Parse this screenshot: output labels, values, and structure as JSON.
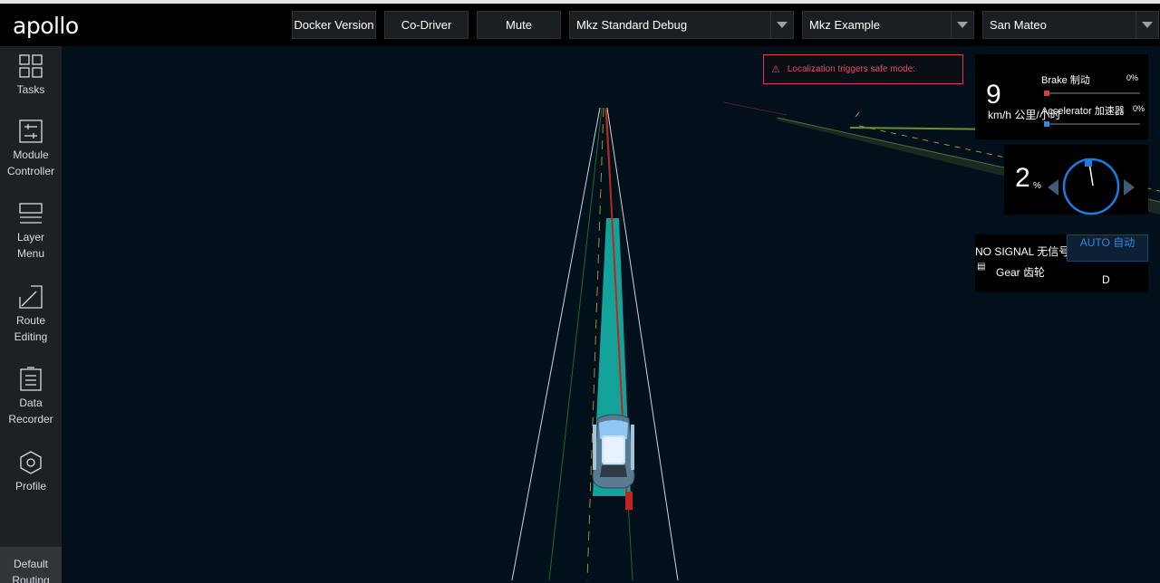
{
  "app": {
    "logo": "apollo"
  },
  "header": {
    "docker_btn": "Docker Version",
    "codriver_btn": "Co-Driver",
    "mute_btn": "Mute",
    "mode_select": "Mkz Standard Debug",
    "vehicle_select": "Mkz Example",
    "map_select": "San Mateo"
  },
  "sidebar": {
    "tasks": "Tasks",
    "module_controller": [
      "Module",
      "Controller"
    ],
    "layer_menu": [
      "Layer",
      "Menu"
    ],
    "route_editing": [
      "Route",
      "Editing"
    ],
    "data_recorder": [
      "Data",
      "Recorder"
    ],
    "profile": "Profile",
    "default_routing": [
      "Default",
      "Routing"
    ]
  },
  "alert": {
    "icon": "warning-triangle-icon",
    "text": "Localization triggers safe mode:"
  },
  "dashboard": {
    "speed": "9",
    "speed_unit": "km/h 公里/小时",
    "brake_label": "Brake 制动",
    "brake_pct": "0%",
    "brake_level": 0,
    "accel_label": "Accelerator 加速器",
    "accel_pct": "0%",
    "accel_level": 0,
    "steering": "2",
    "steering_unit": "%",
    "signal": "NO SIGNAL 无信号",
    "driving_mode": "AUTO 自动",
    "gear_label": "Gear 齿轮",
    "gear": "D"
  },
  "colors": {
    "brake": "#d0413a",
    "accelerator": "#2f87e0",
    "path_teal": "#14a39a",
    "alert": "#e24a62",
    "auto_mode": "#2f87e0"
  }
}
